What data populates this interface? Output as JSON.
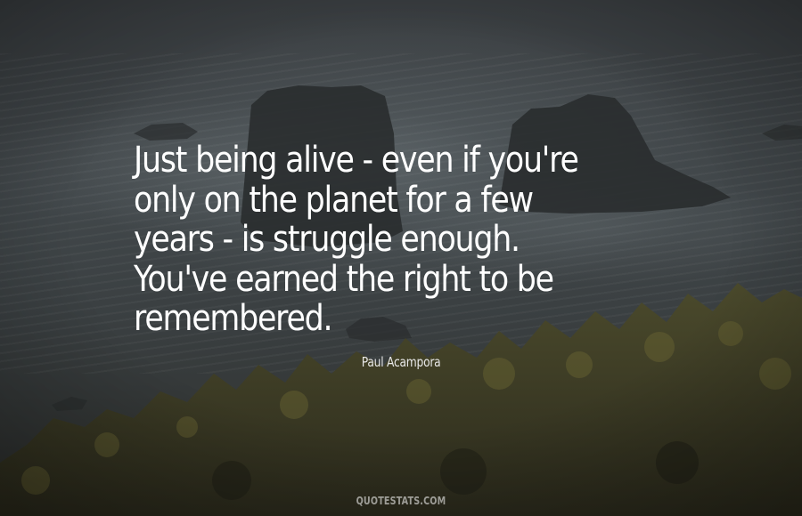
{
  "quote": {
    "lines": [
      "Just being alive - even if you're",
      "only on the planet for a few",
      "years - is struggle enough.",
      "You've earned the right to be",
      "remembered."
    ]
  },
  "author": {
    "name": "Paul Acampora"
  },
  "watermark": {
    "text": "QUOTESTATS.COM"
  },
  "colors": {
    "text": "#ffffff",
    "background": "#3d4245"
  }
}
